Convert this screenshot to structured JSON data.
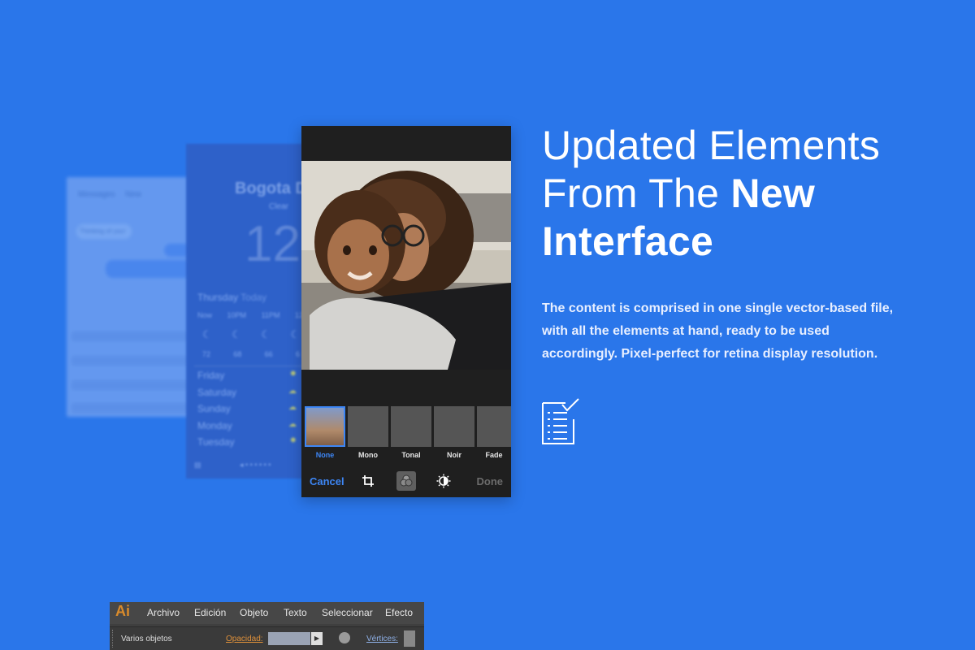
{
  "colors": {
    "background": "#2a76ea",
    "accent": "#3d86f5"
  },
  "headline": {
    "line1": "Updated Elements",
    "line2_light": "From The",
    "line2_bold": "New",
    "line3_bold": "Interface"
  },
  "description": "The content is comprised in one single vector-based file, with all the elements at hand, ready to be used accordingly. Pixel-perfect for retina display resolution.",
  "feature_icon": "checklist-icon",
  "back_messages": {
    "tab_messages": "Messages",
    "tab_new": "New",
    "bubble_text": "Thinking of you!"
  },
  "weather": {
    "city": "Bogota D",
    "condition": "Clear",
    "temperature": "12",
    "day_label": "Thursday",
    "today_label": "Today",
    "hours": [
      "Now",
      "10PM",
      "11PM",
      "12"
    ],
    "hour_temps": [
      "72",
      "68",
      "66",
      "6"
    ],
    "days": [
      "Friday",
      "Saturday",
      "Sunday",
      "Monday",
      "Tuesday"
    ]
  },
  "photo_editor": {
    "filters": [
      "None",
      "Mono",
      "Tonal",
      "Noir",
      "Fade"
    ],
    "selected_filter": "None",
    "cancel_label": "Cancel",
    "done_label": "Done",
    "tools": [
      "crop-icon",
      "filters-icon",
      "adjust-icon"
    ]
  },
  "illustrator": {
    "logo": "Ai",
    "menu": [
      "Archivo",
      "Edición",
      "Objeto",
      "Texto",
      "Seleccionar",
      "Efecto"
    ],
    "selection": "Varios objetos",
    "opacity_label": "Opacidad:",
    "vertices_label": "Vértices:"
  }
}
